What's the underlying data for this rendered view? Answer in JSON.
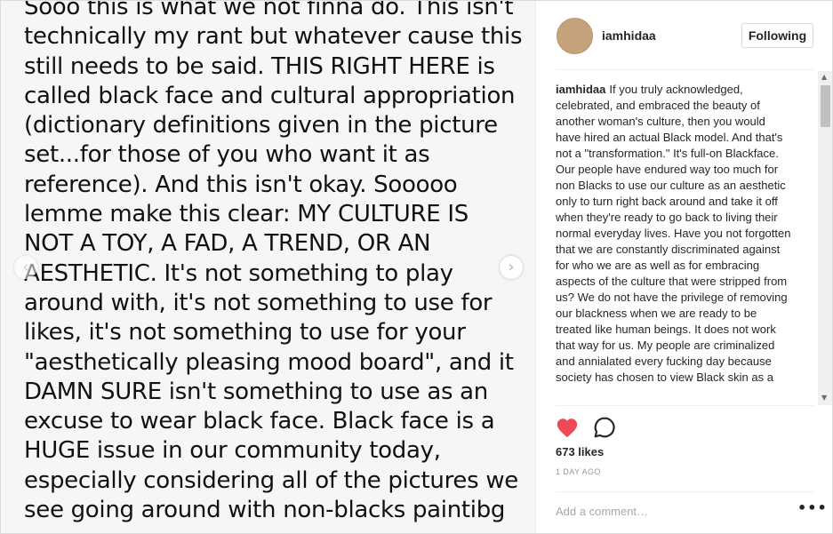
{
  "media": {
    "text": "Sooo this is what we not finna do. This isn't\ntechnically my rant but whatever cause this\nstill needs to be said. THIS RIGHT HERE is\ncalled black face and cultural appropriation\n(dictionary definitions given in the picture\nset...for those of you who want it as\nreference). And this isn't okay. Sooooo\nlemme make this clear: MY CULTURE IS\nNOT A TOY, A FAD, A TREND, OR AN\nAESTHETIC. It's not something to play\naround with, it's not something to use for\nlikes, it's not something to use for your\n\"aesthetically pleasing mood board\", and it\nDAMN SURE isn't something to use as an\nexcuse to wear black face. Black face is a\nHUGE issue in our community today,\nespecially considering all of the pictures we\nsee going around with non-blacks paintibg",
    "prev_icon": "chevron-left-icon",
    "next_icon": "chevron-right-icon"
  },
  "header": {
    "username": "iamhidaa",
    "follow_label": "Following",
    "avatar_color": "#c5a27c"
  },
  "caption": {
    "username": "iamhidaa",
    "text": "If you truly acknowledged, celebrated, and embraced the beauty of another woman's culture, then you would have hired an actual Black model. And that's not a \"transformation.\" It's full-on Blackface. Our people have endured way too much for non Blacks to use our culture as an aesthetic only to turn right back around and take it off when they're ready to go back to living their normal everyday lives. Have you not forgotten that we are constantly discriminated against for who we are as well as for embracing aspects of the culture that were stripped from us? We do not have the privilege of removing our blackness when we are ready to be treated like human beings. It does not work that way for us. My people are criminalized and annialated every fucking day because society has chosen to view Black skin as a"
  },
  "actions": {
    "like_icon": "heart-icon",
    "like_color": "#ed4956",
    "comment_icon": "comment-bubble-icon"
  },
  "likes": "673 likes",
  "timestamp": "1 DAY AGO",
  "comment_box": {
    "placeholder": "Add a comment…",
    "more_icon": "more-options-icon",
    "more_label": "•••"
  }
}
